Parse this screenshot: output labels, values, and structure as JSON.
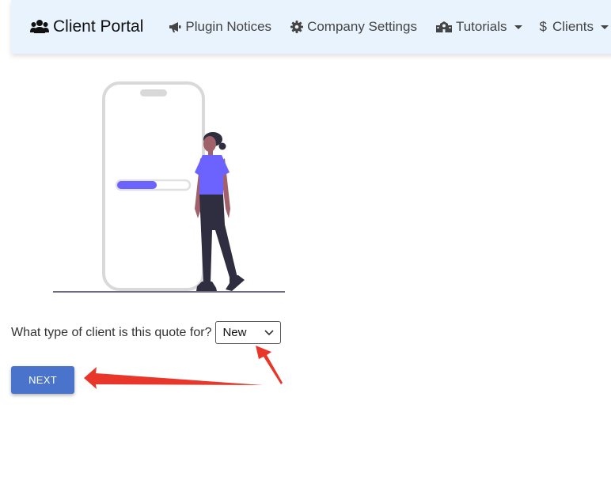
{
  "navbar": {
    "brand": "Client Portal",
    "brand_icon": "users-icon",
    "items": [
      {
        "label": "Plugin Notices",
        "icon": "megaphone-icon"
      },
      {
        "label": "Company Settings",
        "icon": "gear-icon"
      },
      {
        "label": "Tutorials",
        "icon": "school-icon",
        "dropdown": true
      },
      {
        "label": "Clients",
        "icon": "dollar-icon",
        "dropdown": true
      }
    ]
  },
  "illustration": {
    "name": "phone-progress-illustration",
    "progress_fraction": 0.55
  },
  "form": {
    "question": "What type of client is this quote for?",
    "client_type_selected": "New"
  },
  "next_button": {
    "label": "NEXT"
  },
  "annotations": {
    "arrow_color": "#e8362a"
  },
  "colors": {
    "navbar_bg": "#e8f3fd",
    "button_bg": "#4a74cc",
    "illustration_accent": "#6c63ff"
  }
}
